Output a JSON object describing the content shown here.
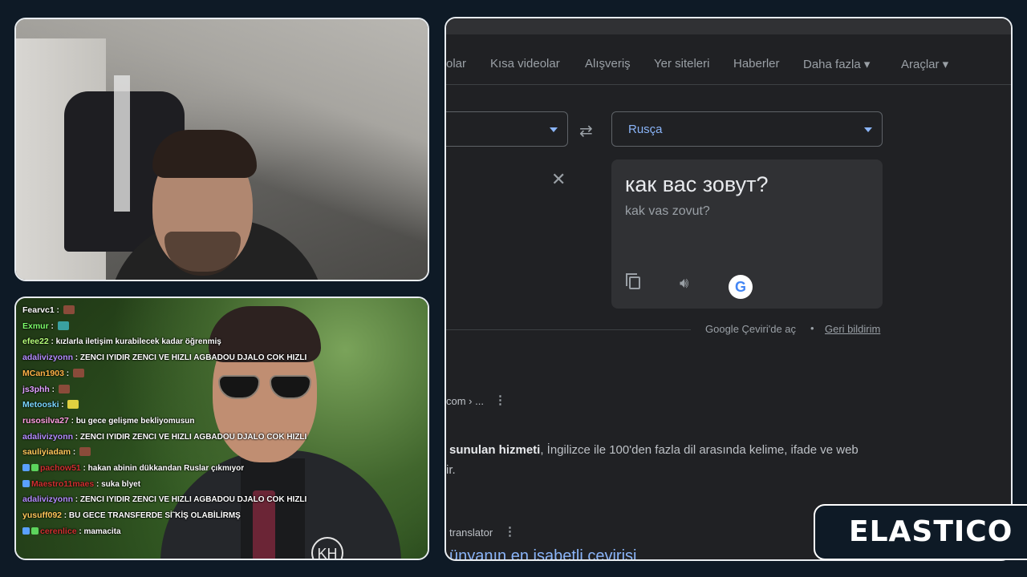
{
  "browser": {
    "nav": [
      "olar",
      "Kısa videolar",
      "Alışveriş",
      "Yer siteleri",
      "Haberler",
      "Daha fazla",
      "Araçlar"
    ],
    "target_language": "Rusça",
    "translation": "как вас зовут?",
    "transliteration": "kak vas zovut?",
    "footer_open": "Google Çeviri'de aç",
    "footer_dot": "•",
    "footer_feedback": "Geri bildirim",
    "result_breadcrumb": "com › ...",
    "snippet_bold": "sunulan hizmeti",
    "snippet_rest": ", İngilizce ile 100'den fazla dil arasında kelime, ifade ve web",
    "snippet_line2": "ir.",
    "result_source": "translator",
    "result_title": "ünyanın en isabetli çevirisi",
    "accent_color": "#8ab4f8"
  },
  "chat": [
    {
      "user": "Fearvc1",
      "color": "#ffffff",
      "text": "",
      "emote": "#8a4b3a"
    },
    {
      "user": "Exmur",
      "color": "#7dff6a",
      "text": "",
      "emote": "#3aa0a0"
    },
    {
      "user": "efee22",
      "color": "#b7ff7a",
      "text": "kızlarla iletişim kurabilecek kadar öğrenmiş",
      "emote": ""
    },
    {
      "user": "adalivizyonn",
      "color": "#b48cff",
      "text": "ZENCI IYIDIR ZENCI VE HIZLI AGBADOU DJALO COK HIZLI",
      "emote": ""
    },
    {
      "user": "MCan1903",
      "color": "#ffb347",
      "text": "",
      "emote": "#8a4b3a"
    },
    {
      "user": "js3phh",
      "color": "#e0a0ff",
      "text": "",
      "emote": "#8a4b3a"
    },
    {
      "user": "Metooski",
      "color": "#7ad7ff",
      "text": "",
      "emote": "#e0d040"
    },
    {
      "user": "rusosilva27",
      "color": "#ff9fe0",
      "text": "bu gece gelişme bekliyomusun",
      "emote": ""
    },
    {
      "user": "adalivizyonn",
      "color": "#b48cff",
      "text": "ZENCI IYIDIR ZENCI VE HIZLI AGBADOU DJALO COK HIZLI",
      "emote": ""
    },
    {
      "user": "sauliyiadam",
      "color": "#ffc85a",
      "text": "",
      "emote": "#8a4b3a"
    },
    {
      "user": "pachow51",
      "color": "#d03030",
      "text": "hakan abinin dükkandan Ruslar çıkmıyor",
      "emote": "",
      "badges": 2
    },
    {
      "user": "Maestro11maes",
      "color": "#d03030",
      "text": "suka blyet",
      "emote": "",
      "badges": 1
    },
    {
      "user": "adalivizyonn",
      "color": "#b48cff",
      "text": "ZENCI IYIDIR ZENCI VE HIZLI AGBADOU DJALO COK HIZLI",
      "emote": ""
    },
    {
      "user": "yusuff092",
      "color": "#ffc85a",
      "text": "BU GECE TRANSFERDE Sİ˜KİŞ OLABİLİRMŞ",
      "emote": ""
    },
    {
      "user": "cerenlice",
      "color": "#d03030",
      "text": "mamacita",
      "emote": "",
      "badges": 2
    }
  ],
  "logo": {
    "text": "ELASTICO"
  },
  "overlay": {
    "kh": "KH"
  }
}
